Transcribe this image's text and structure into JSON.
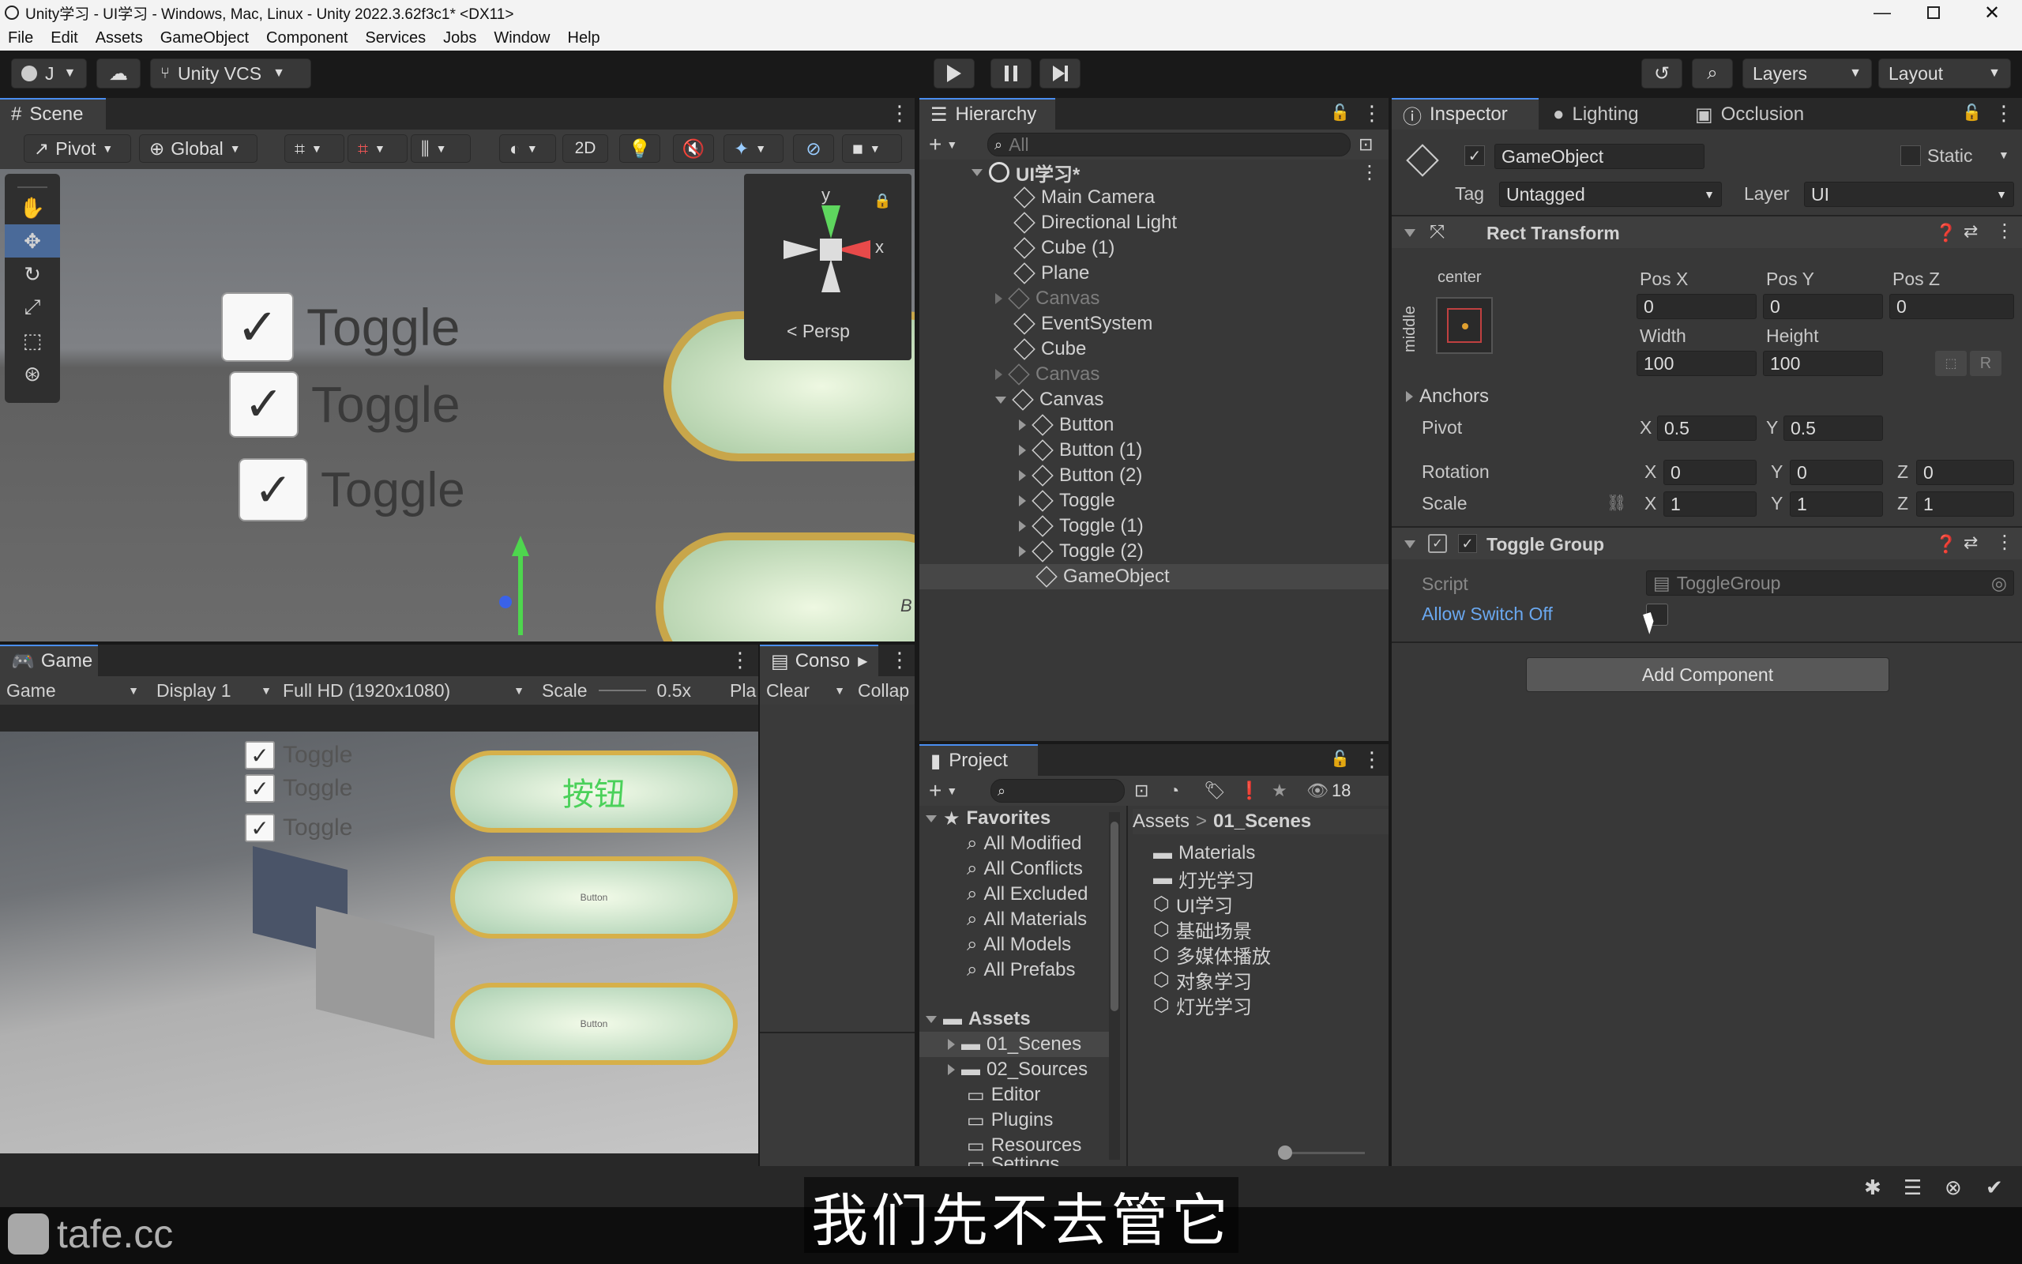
{
  "window": {
    "title": "Unity学习 - UI学习 - Windows, Mac, Linux - Unity 2022.3.62f3c1* <DX11>"
  },
  "menu": [
    "File",
    "Edit",
    "Assets",
    "GameObject",
    "Component",
    "Services",
    "Jobs",
    "Window",
    "Help"
  ],
  "toolbar": {
    "account": "J",
    "vcs": "Unity VCS",
    "layers": "Layers",
    "layout": "Layout"
  },
  "scene": {
    "tab": "Scene",
    "pivot": "Pivot",
    "global": "Global",
    "mode2d": "2D",
    "persp": "< Persp",
    "gizmo_y": "y",
    "gizmo_x": "x",
    "toggles": [
      "Toggle",
      "Toggle",
      "Toggle"
    ],
    "button_hint": "B"
  },
  "game": {
    "tab": "Game",
    "mode": "Game",
    "display": "Display 1",
    "resolution": "Full HD (1920x1080)",
    "scale_label": "Scale",
    "scale_value": "0.5x",
    "play_label": "Pla",
    "toggles": [
      "Toggle",
      "Toggle",
      "Toggle"
    ],
    "buttons": [
      "按钮",
      "Button",
      "Button"
    ]
  },
  "console": {
    "tab": "Conso",
    "clear": "Clear",
    "collapse": "Collap"
  },
  "hierarchy": {
    "tab": "Hierarchy",
    "search_placeholder": "All",
    "scene": "UI学习*",
    "items": [
      "Main Camera",
      "Directional Light",
      "Cube (1)",
      "Plane",
      "Canvas",
      "EventSystem",
      "Cube",
      "Canvas",
      "Canvas",
      "Button",
      "Button (1)",
      "Button (2)",
      "Toggle",
      "Toggle (1)",
      "Toggle (2)",
      "GameObject"
    ]
  },
  "project": {
    "tab": "Project",
    "count": "18",
    "favorites": "Favorites",
    "fav_items": [
      "All Modified",
      "All Conflicts",
      "All Excluded",
      "All Materials",
      "All Models",
      "All Prefabs"
    ],
    "assets": "Assets",
    "asset_items": [
      "01_Scenes",
      "02_Sources",
      "Editor",
      "Plugins",
      "Resources"
    ],
    "asset_more": "Settings",
    "breadcrumb_root": "Assets",
    "breadcrumb_sep": ">",
    "breadcrumb_leaf": "01_Scenes",
    "files": [
      "Materials",
      "灯光学习",
      "UI学习",
      "基础场景",
      "多媒体播放",
      "对象学习",
      "灯光学习"
    ]
  },
  "inspector": {
    "tabs": [
      "Inspector",
      "Lighting",
      "Occlusion"
    ],
    "name": "GameObject",
    "static": "Static",
    "tag_label": "Tag",
    "tag": "Untagged",
    "layer_label": "Layer",
    "layer": "UI",
    "rect": {
      "title": "Rect Transform",
      "anchor_h": "center",
      "anchor_v": "middle",
      "posx_l": "Pos X",
      "posy_l": "Pos Y",
      "posz_l": "Pos Z",
      "posx": "0",
      "posy": "0",
      "posz": "0",
      "width_l": "Width",
      "height_l": "Height",
      "width": "100",
      "height": "100",
      "anchors": "Anchors",
      "pivot": "Pivot",
      "pivot_x": "0.5",
      "pivot_y": "0.5",
      "rotation": "Rotation",
      "rot_x": "0",
      "rot_y": "0",
      "rot_z": "0",
      "scale": "Scale",
      "scale_x": "1",
      "scale_y": "1",
      "scale_z": "1",
      "x": "X",
      "y": "Y",
      "z": "Z",
      "r_btn": "R"
    },
    "toggle_group": {
      "title": "Toggle Group",
      "script_label": "Script",
      "script": "ToggleGroup",
      "allow_label": "Allow Switch Off"
    },
    "add_component": "Add Component"
  },
  "subtitle": "我们先不去管它",
  "watermark": "tafe.cc"
}
